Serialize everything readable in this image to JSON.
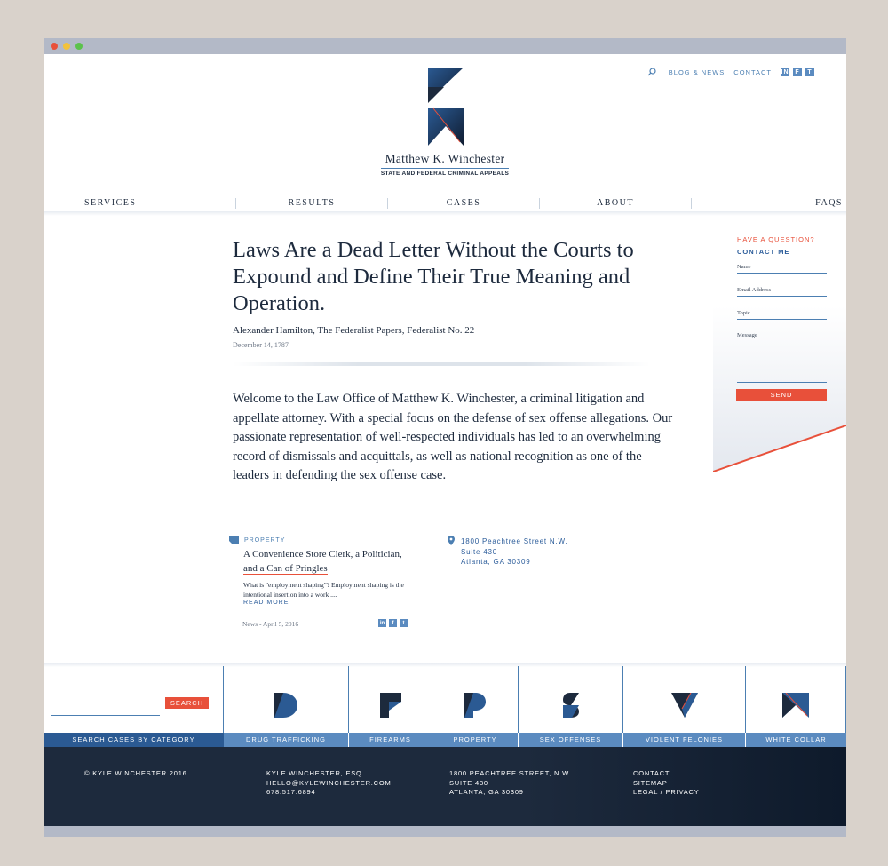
{
  "header": {
    "top_links": [
      "Blog & News",
      "Contact"
    ],
    "social": [
      "in",
      "f",
      "t"
    ],
    "name": "Matthew K. Winchester",
    "tagline": "STATE AND FEDERAL CRIMINAL APPEALS"
  },
  "nav": [
    "Services",
    "Results",
    "Cases",
    "About",
    "FAQs"
  ],
  "quote": {
    "headline": "Laws Are a Dead Letter Without the Courts to Expound and Define Their True Meaning and Operation.",
    "attribution": "Alexander Hamilton, The Federalist Papers, Federalist No. 22",
    "date": "December 14, 1787"
  },
  "intro": "Welcome to the Law Office of Matthew K. Winchester, a criminal litigation and appellate attorney. With a special focus on the defense of sex offense allegations. Our passionate representation of well-respected individuals has led to an overwhelming record of dismissals and acquittals, as well as national recognition as one of the leaders in defending the sex offense case.",
  "contact": {
    "question": "HAVE A QUESTION?",
    "contact_me": "CONTACT ME",
    "fields": [
      "Name",
      "Email Address",
      "Topic",
      "Message"
    ],
    "send": "SEND"
  },
  "article": {
    "category": "Property",
    "title_line1": "A Convenience Store Clerk, a Politician,",
    "title_line2": "and a Can of Pringles",
    "excerpt": "What is \"employment shaping\"? Employment shaping is the intentional insertion into a work ....",
    "read_more": "Read More",
    "meta": "News  -  April 5, 2016"
  },
  "address": {
    "line1": "1800 Peachtree Street N.W.",
    "line2": "Suite 430",
    "line3": "Atlanta, GA 30309"
  },
  "search": {
    "button": "SEARCH",
    "label": "SEARCH CASES BY CATEGORY"
  },
  "categories": [
    "DRUG TRAFFICKING",
    "FIREARMS",
    "PROPERTY",
    "SEX OFFENSES",
    "VIOLENT FELONIES",
    "WHITE COLLAR"
  ],
  "footer": {
    "copyright": "© KYLE WINCHESTER 2016",
    "person": [
      "KYLE WINCHESTER, ESQ.",
      "HELLO@KYLEWINCHESTER.COM",
      "678.517.6894"
    ],
    "addr": [
      "1800 PEACHTREE STREET, N.W.",
      "SUITE 430",
      "ATLANTA, GA 30309"
    ],
    "links": [
      "CONTACT",
      "SITEMAP",
      "LEGAL / PRIVACY"
    ]
  },
  "colors": {
    "navy": "#1d2a3d",
    "blue": "#4c7fb2",
    "accent": "#e8503a"
  }
}
